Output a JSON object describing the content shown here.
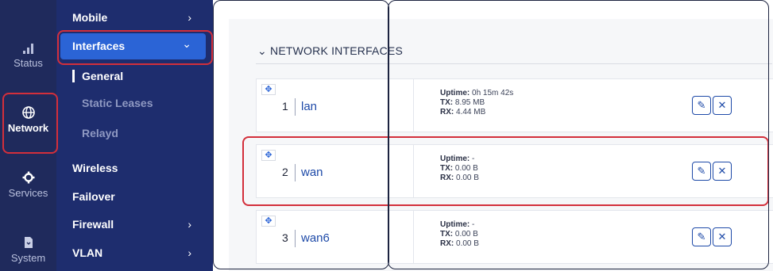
{
  "rail": {
    "items": [
      {
        "label": "Status",
        "icon": "signal-bars-icon"
      },
      {
        "label": "Network",
        "icon": "globe-icon"
      },
      {
        "label": "Services",
        "icon": "gear-icon"
      },
      {
        "label": "System",
        "icon": "document-icon"
      }
    ]
  },
  "menu": {
    "items": [
      {
        "label": "Mobile",
        "arrow": "›"
      },
      {
        "label": "Interfaces",
        "arrow": "⌄"
      },
      {
        "label": "Wireless"
      },
      {
        "label": "Failover"
      },
      {
        "label": "Firewall",
        "arrow": "›"
      },
      {
        "label": "VLAN",
        "arrow": "›"
      }
    ],
    "subitems": [
      "General",
      "Static Leases",
      "Relayd"
    ]
  },
  "section": {
    "toggle": "⌄",
    "title": "NETWORK INTERFACES"
  },
  "labels": {
    "uptime": "Uptime:",
    "tx": "TX:",
    "rx": "RX:"
  },
  "interfaces": [
    {
      "num": "1",
      "name": "lan",
      "uptime": "0h 15m 42s",
      "tx": "8.95 MB",
      "rx": "4.44 MB"
    },
    {
      "num": "2",
      "name": "wan",
      "uptime": "-",
      "tx": "0.00 B",
      "rx": "0.00 B"
    },
    {
      "num": "3",
      "name": "wan6",
      "uptime": "-",
      "tx": "0.00 B",
      "rx": "0.00 B"
    }
  ],
  "colors": {
    "rail_bg": "#1f2a5c",
    "menu_bg": "#1e2d6e",
    "accent": "#2b64d6",
    "annotation": "#d32f3b"
  }
}
